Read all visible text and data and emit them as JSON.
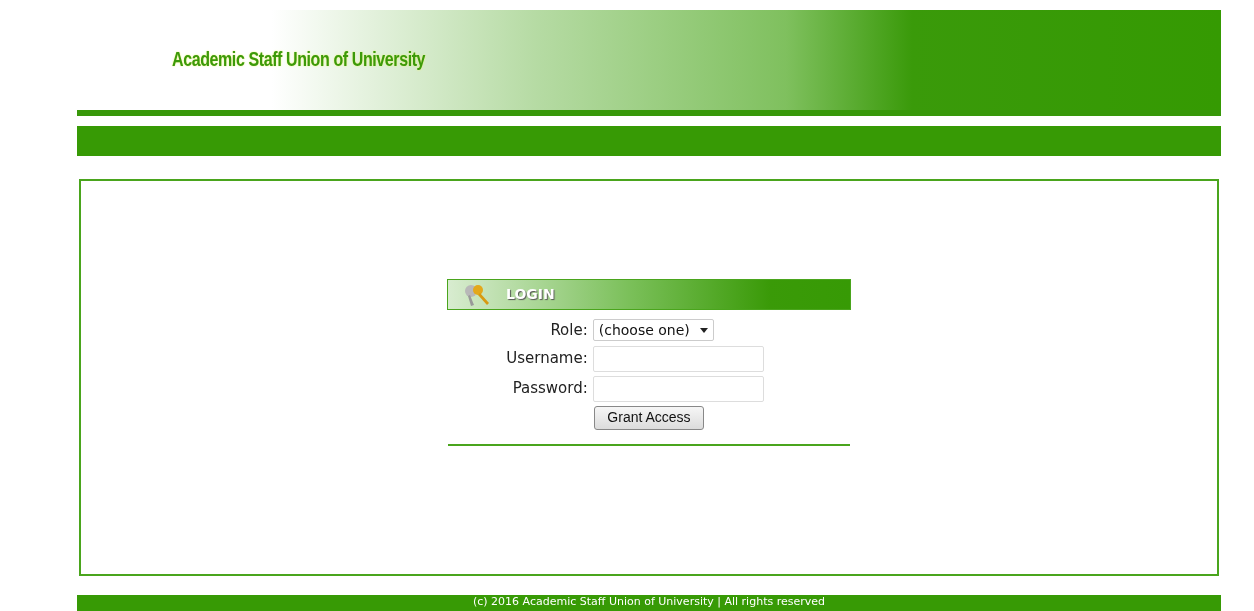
{
  "header": {
    "title": "Academic Staff Union of University"
  },
  "login": {
    "title": "LOGIN",
    "fields": [
      {
        "kind": "select",
        "label": "Role:",
        "value": "(choose one)"
      },
      {
        "kind": "text",
        "label": "Username:"
      },
      {
        "kind": "password",
        "label": "Password:"
      }
    ],
    "button": "Grant Access"
  },
  "footer": "(c) 2016 Academic Staff Union of University | All rights reserved"
}
